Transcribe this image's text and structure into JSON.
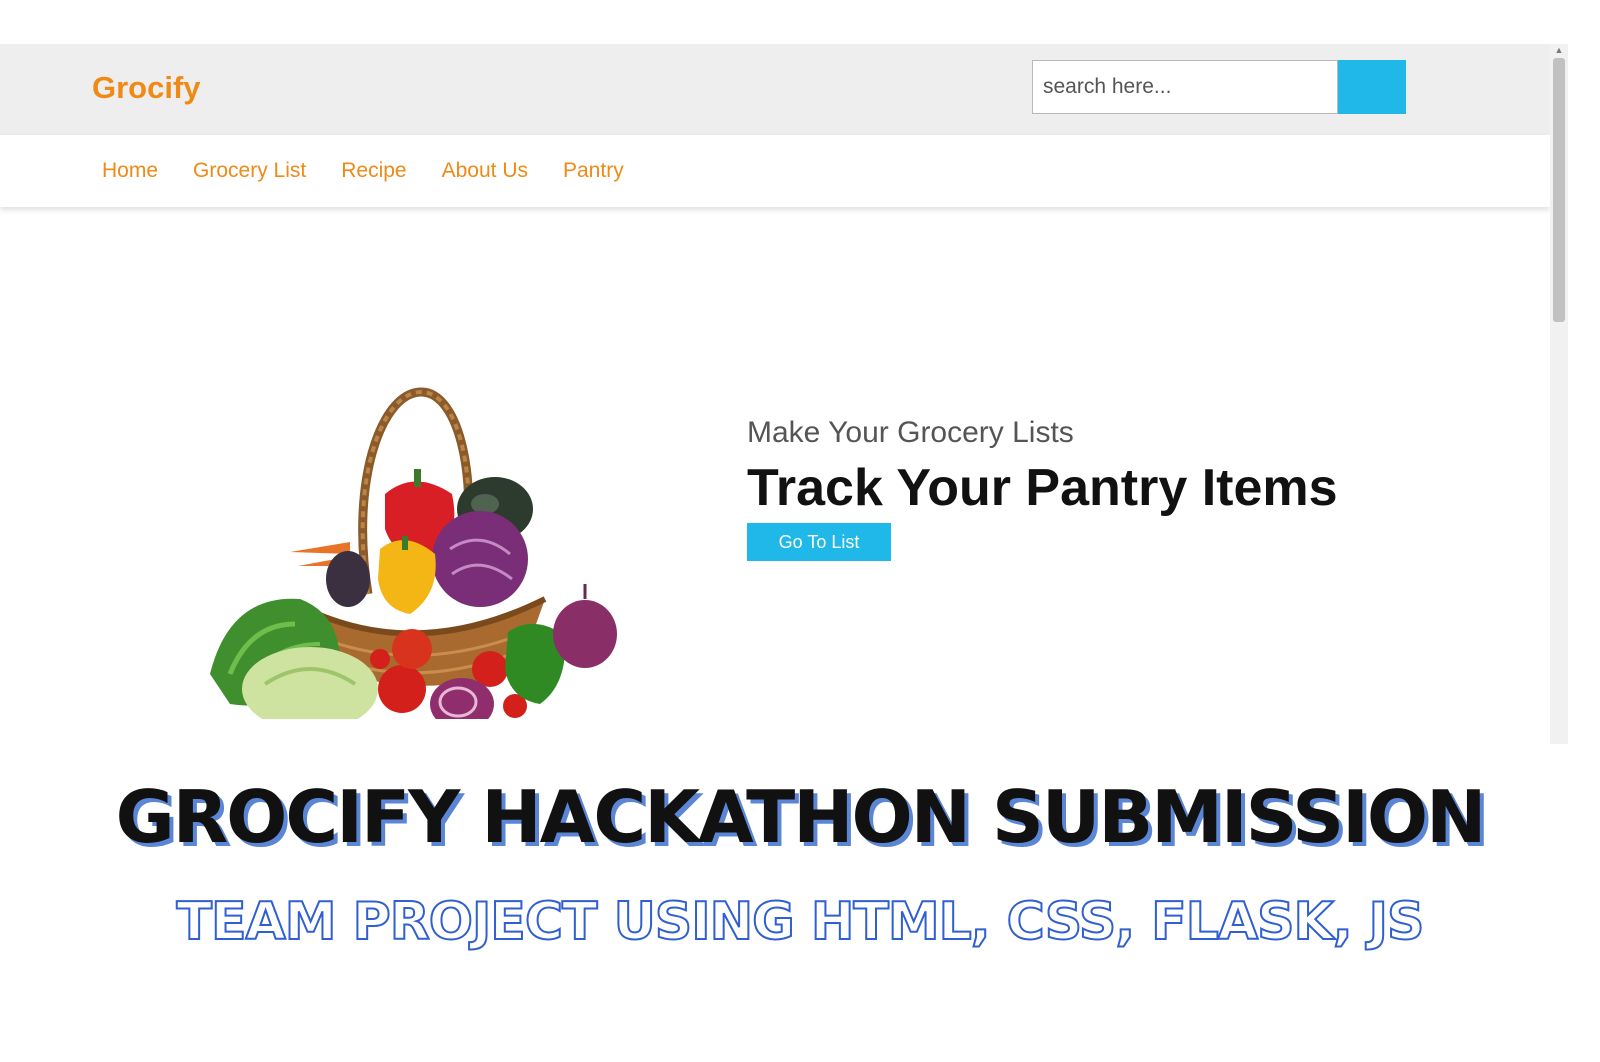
{
  "header": {
    "brand": "Grocify",
    "search_placeholder": "search here..."
  },
  "nav": {
    "items": [
      {
        "label": "Home"
      },
      {
        "label": "Grocery List"
      },
      {
        "label": "Recipe"
      },
      {
        "label": "About Us"
      },
      {
        "label": "Pantry"
      }
    ]
  },
  "hero": {
    "subtitle": "Make Your Grocery Lists",
    "title": "Track Your Pantry Items",
    "button_label": "Go To List"
  },
  "banner": {
    "title": "GROCIFY HACKATHON SUBMISSION",
    "subtitle": "TEAM PROJECT USING HTML, CSS, FLASK, JS"
  },
  "colors": {
    "brand": "#f08a16",
    "accent": "#1fb8e8",
    "banner_shadow": "#5b86d6",
    "banner_outline": "#2f5fd0"
  }
}
